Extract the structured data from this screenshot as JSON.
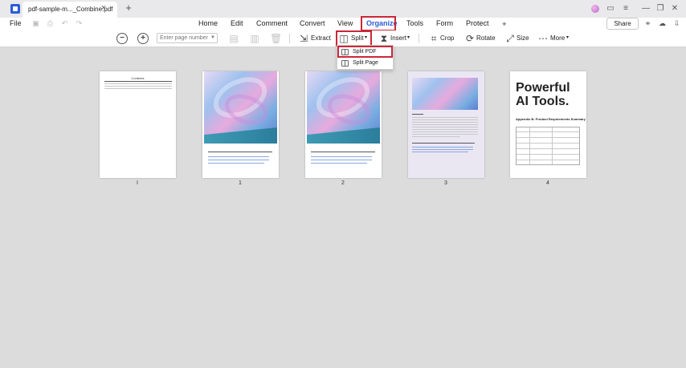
{
  "tab": {
    "title": "pdf-sample-m..._Combine.pdf",
    "close": "×",
    "new_tab": "+"
  },
  "menu": {
    "file": "File",
    "items": [
      "Home",
      "Edit",
      "Comment",
      "Convert",
      "View",
      "Organize",
      "Tools",
      "Form",
      "Protect"
    ],
    "active": "Organize",
    "share": "Share"
  },
  "toolbar": {
    "page_input_placeholder": "Enter page number",
    "extract": "Extract",
    "split": "Split",
    "insert": "Insert",
    "crop": "Crop",
    "rotate": "Rotate",
    "size": "Size",
    "more": "More"
  },
  "split_menu": {
    "items": [
      "Split PDF",
      "Split Page"
    ],
    "highlighted": "Split PDF"
  },
  "pages": [
    {
      "label": "I",
      "type": "toc",
      "toc_title": "Contents"
    },
    {
      "label": "1",
      "type": "cover"
    },
    {
      "label": "2",
      "type": "cover"
    },
    {
      "label": "3",
      "type": "text",
      "selected": true
    },
    {
      "label": "4",
      "type": "slide",
      "headline": "Powerful AI Tools.",
      "subheading": "Appendix B: Product Requirements Summary"
    }
  ],
  "colors": {
    "accent": "#2c5bd8",
    "highlight": "#c9283a",
    "selected_page": "#eae7f3"
  },
  "icons": {
    "zoom_out": "minus-circle-icon",
    "zoom_in": "plus-circle-icon",
    "extract": "extract-icon",
    "split": "split-icon",
    "insert": "insert-icon",
    "crop": "crop-icon",
    "rotate": "rotate-icon",
    "size": "size-icon",
    "more": "more-icon"
  }
}
